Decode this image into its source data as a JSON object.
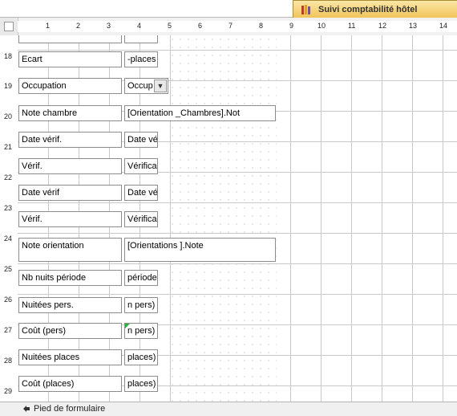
{
  "document_tab": {
    "title": "Suivi comptabilité hôtel",
    "icon": "report-icon"
  },
  "ruler_numbers": [
    "1",
    "2",
    "3",
    "4",
    "5",
    "6",
    "7",
    "8",
    "9",
    "10",
    "11",
    "12",
    "13",
    "14"
  ],
  "vertical_numbers": [
    "18",
    "19",
    "20",
    "21",
    "22",
    "23",
    "24",
    "25",
    "26",
    "27",
    "28",
    "29"
  ],
  "rows": [
    {
      "label": "Ecart",
      "control": "-places"
    },
    {
      "label": "Occupation",
      "control": "Occup"
    },
    {
      "label": "Note chambre",
      "control": "[Orientation          _Chambres].Not"
    },
    {
      "label": "Date vérif.",
      "control": "Date vé"
    },
    {
      "label": "Vérif.",
      "control": "Vérifica"
    },
    {
      "label": "Date vérif",
      "control": "Date vé"
    },
    {
      "label": "Vérif.",
      "control": "Vérifica"
    },
    {
      "label": "Note orientation",
      "control": "[Orientations        ].Note"
    },
    {
      "label": "Nb nuits période",
      "control": "période"
    },
    {
      "label": "Nuitées pers.",
      "control": "n pers)"
    },
    {
      "label": "Coût        (pers)",
      "control": "n pers)"
    },
    {
      "label": "Nuitées places",
      "control": "places)"
    },
    {
      "label": "Coût        (places)",
      "control": "places)"
    }
  ],
  "footer": {
    "label": "Pied de formulaire"
  }
}
